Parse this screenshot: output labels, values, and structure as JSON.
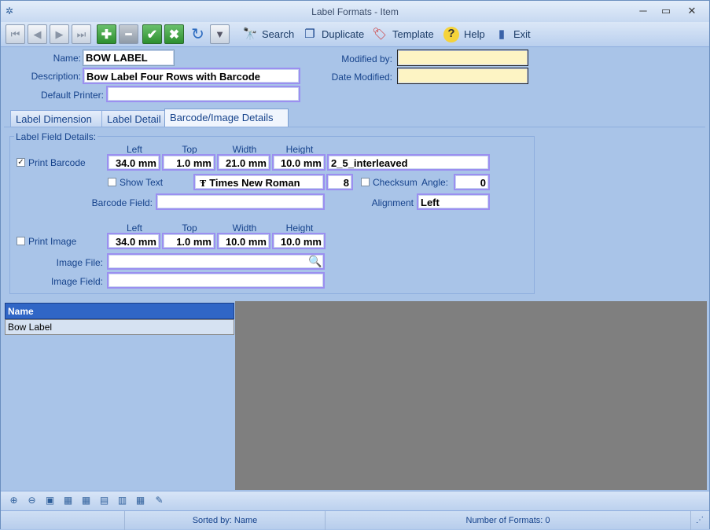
{
  "window": {
    "title": "Label Formats - Item",
    "minimize": "─",
    "maximize": "▭",
    "close": "✕"
  },
  "toolbar": {
    "search_label": "Search",
    "duplicate_label": "Duplicate",
    "template_label": "Template",
    "help_label": "Help",
    "exit_label": "Exit"
  },
  "form": {
    "name_label": "Name:",
    "name_value": "BOW LABEL",
    "description_label": "Description:",
    "description_value": "Bow Label Four Rows with Barcode",
    "default_printer_label": "Default Printer:",
    "default_printer_value": "",
    "modified_by_label": "Modified by:",
    "modified_by_value": "",
    "date_modified_label": "Date Modified:",
    "date_modified_value": ""
  },
  "tabs": [
    {
      "label": "Label Dimension"
    },
    {
      "label": "Label Detail"
    },
    {
      "label": "Barcode/Image Details"
    }
  ],
  "details": {
    "group_title": "Label Field Details:",
    "col_left": "Left",
    "col_top": "Top",
    "col_width": "Width",
    "col_height": "Height",
    "print_barcode_label": "Print Barcode",
    "print_barcode_checked": true,
    "barcode_left": "34.0 mm",
    "barcode_top": "1.0 mm",
    "barcode_width": "21.0 mm",
    "barcode_height": "10.0 mm",
    "barcode_type": "2_5_interleaved",
    "show_text_label": "Show Text",
    "font_name": "Times New Roman",
    "font_size": "8",
    "checksum_label": "Checksum",
    "angle_label": "Angle:",
    "angle_value": "0",
    "barcode_field_label": "Barcode Field:",
    "barcode_field_value": "",
    "alignment_label": "Alignment",
    "alignment_value": "Left",
    "print_image_label": "Print Image",
    "image_left": "34.0 mm",
    "image_top": "1.0 mm",
    "image_width": "10.0 mm",
    "image_height": "10.0 mm",
    "image_file_label": "Image File:",
    "image_file_value": "",
    "image_field_label": "Image Field:",
    "image_field_value": ""
  },
  "grid": {
    "header": "Name",
    "rows": [
      "Bow Label"
    ]
  },
  "status": {
    "sorted_by": "Sorted by: Name",
    "count": "Number of Formats: 0"
  }
}
